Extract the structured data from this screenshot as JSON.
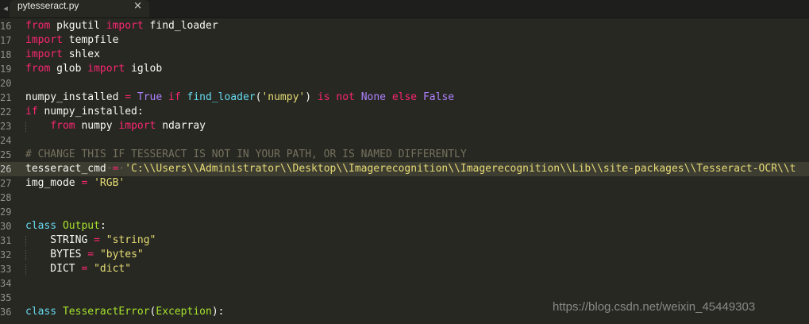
{
  "window": {
    "tab_scroll_icon": "tab-scroll-left-icon",
    "tab": {
      "label": "pytesseract.py",
      "close_glyph": "×"
    }
  },
  "colors": {
    "background": "#272822",
    "default": "#f8f8f2",
    "keyword": "#f92672",
    "constant": "#ae81ff",
    "string": "#e6db74",
    "builtin": "#66d9ef",
    "classname": "#a6e22e",
    "comment": "#75715e"
  },
  "editor": {
    "active_line": "26",
    "lines": [
      {
        "n": "16",
        "tokens": [
          {
            "t": "from",
            "c": "keyword"
          },
          {
            "t": " pkgutil ",
            "c": "default"
          },
          {
            "t": "import",
            "c": "keyword"
          },
          {
            "t": " find_loader",
            "c": "default"
          }
        ]
      },
      {
        "n": "17",
        "tokens": [
          {
            "t": "import",
            "c": "keyword"
          },
          {
            "t": " tempfile",
            "c": "default"
          }
        ]
      },
      {
        "n": "18",
        "tokens": [
          {
            "t": "import",
            "c": "keyword"
          },
          {
            "t": " shlex",
            "c": "default"
          }
        ]
      },
      {
        "n": "19",
        "tokens": [
          {
            "t": "from",
            "c": "keyword"
          },
          {
            "t": " glob ",
            "c": "default"
          },
          {
            "t": "import",
            "c": "keyword"
          },
          {
            "t": " iglob",
            "c": "default"
          }
        ]
      },
      {
        "n": "20",
        "tokens": []
      },
      {
        "n": "21",
        "tokens": [
          {
            "t": "numpy_installed ",
            "c": "default"
          },
          {
            "t": "=",
            "c": "keyword"
          },
          {
            "t": " ",
            "c": "default"
          },
          {
            "t": "True",
            "c": "constant"
          },
          {
            "t": " ",
            "c": "default"
          },
          {
            "t": "if",
            "c": "keyword"
          },
          {
            "t": " ",
            "c": "default"
          },
          {
            "t": "find_loader",
            "c": "builtin"
          },
          {
            "t": "(",
            "c": "default"
          },
          {
            "t": "'numpy'",
            "c": "string"
          },
          {
            "t": ") ",
            "c": "default"
          },
          {
            "t": "is not",
            "c": "keyword"
          },
          {
            "t": " ",
            "c": "default"
          },
          {
            "t": "None",
            "c": "constant"
          },
          {
            "t": " ",
            "c": "default"
          },
          {
            "t": "else",
            "c": "keyword"
          },
          {
            "t": " ",
            "c": "default"
          },
          {
            "t": "False",
            "c": "constant"
          }
        ]
      },
      {
        "n": "22",
        "tokens": [
          {
            "t": "if",
            "c": "keyword"
          },
          {
            "t": " numpy_installed:",
            "c": "default"
          }
        ]
      },
      {
        "n": "23",
        "tokens": [
          {
            "t": "    ",
            "c": "default"
          },
          {
            "t": "from",
            "c": "keyword"
          },
          {
            "t": " numpy ",
            "c": "default"
          },
          {
            "t": "import",
            "c": "keyword"
          },
          {
            "t": " ndarray",
            "c": "default"
          }
        ]
      },
      {
        "n": "24",
        "tokens": []
      },
      {
        "n": "25",
        "tokens": [
          {
            "t": "# CHANGE THIS IF TESSERACT IS NOT IN YOUR PATH, OR IS NAMED DIFFERENTLY",
            "c": "comment"
          }
        ]
      },
      {
        "n": "26",
        "tokens": [
          {
            "t": "tesseract_cmd",
            "c": "default"
          },
          {
            "t": "·",
            "c": "comment"
          },
          {
            "t": "=",
            "c": "keyword"
          },
          {
            "t": "·",
            "c": "comment"
          },
          {
            "t": "'C:\\\\Users\\\\Administrator\\\\Desktop\\\\Imagerecognition\\\\Imagerecognition\\\\Lib\\\\site-packages\\\\Tesseract-OCR\\\\t",
            "c": "string"
          }
        ]
      },
      {
        "n": "27",
        "tokens": [
          {
            "t": "img_mode ",
            "c": "default"
          },
          {
            "t": "=",
            "c": "keyword"
          },
          {
            "t": " ",
            "c": "default"
          },
          {
            "t": "'RGB'",
            "c": "string"
          }
        ]
      },
      {
        "n": "28",
        "tokens": []
      },
      {
        "n": "29",
        "tokens": []
      },
      {
        "n": "30",
        "tokens": [
          {
            "t": "class",
            "c": "builtin"
          },
          {
            "t": " ",
            "c": "default"
          },
          {
            "t": "Output",
            "c": "classname"
          },
          {
            "t": ":",
            "c": "default"
          }
        ]
      },
      {
        "n": "31",
        "tokens": [
          {
            "t": "    STRING ",
            "c": "default"
          },
          {
            "t": "=",
            "c": "keyword"
          },
          {
            "t": " ",
            "c": "default"
          },
          {
            "t": "\"string\"",
            "c": "string"
          }
        ]
      },
      {
        "n": "32",
        "tokens": [
          {
            "t": "    BYTES ",
            "c": "default"
          },
          {
            "t": "=",
            "c": "keyword"
          },
          {
            "t": " ",
            "c": "default"
          },
          {
            "t": "\"bytes\"",
            "c": "string"
          }
        ]
      },
      {
        "n": "33",
        "tokens": [
          {
            "t": "    DICT ",
            "c": "default"
          },
          {
            "t": "=",
            "c": "keyword"
          },
          {
            "t": " ",
            "c": "default"
          },
          {
            "t": "\"dict\"",
            "c": "string"
          }
        ]
      },
      {
        "n": "34",
        "tokens": []
      },
      {
        "n": "35",
        "tokens": []
      },
      {
        "n": "36",
        "tokens": [
          {
            "t": "class",
            "c": "builtin"
          },
          {
            "t": " ",
            "c": "default"
          },
          {
            "t": "TesseractError",
            "c": "classname"
          },
          {
            "t": "(",
            "c": "default"
          },
          {
            "t": "Exception",
            "c": "classname"
          },
          {
            "t": "):",
            "c": "default"
          }
        ]
      }
    ]
  },
  "watermark": {
    "text": "https://blog.csdn.net/weixin_45449303"
  }
}
